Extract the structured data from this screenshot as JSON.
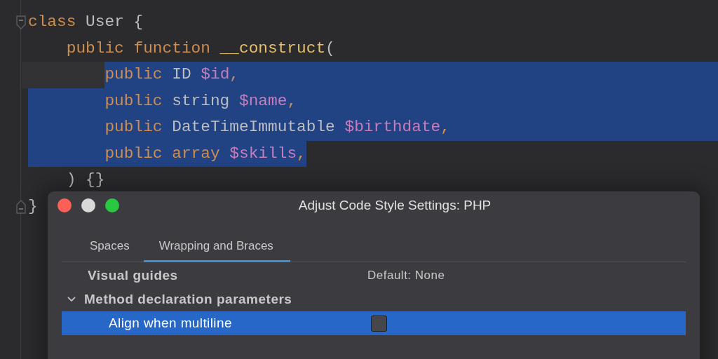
{
  "editor": {
    "lines": [
      {
        "kind": "fold_start",
        "selected": false,
        "current": false,
        "tokens": [
          {
            "kind": "keyword",
            "text": "class"
          },
          {
            "kind": "plain",
            "text": " User {"
          }
        ],
        "children": [
          {
            "selected": false,
            "current": false,
            "tokens": [
              {
                "kind": "keyword",
                "text": "public function "
              },
              {
                "kind": "func",
                "text": "__construct"
              },
              {
                "kind": "plain",
                "text": "("
              }
            ],
            "children": [
              {
                "selected": true,
                "current": true,
                "tokens": [
                  {
                    "kind": "keyword",
                    "text": "public"
                  },
                  {
                    "kind": "plain",
                    "text": " ID "
                  },
                  {
                    "kind": "var",
                    "text": "$id"
                  },
                  {
                    "kind": "keyword",
                    "text": ","
                  }
                ]
              },
              {
                "selected": true,
                "current": false,
                "tokens": [
                  {
                    "kind": "keyword",
                    "text": "public"
                  },
                  {
                    "kind": "plain",
                    "text": " string "
                  },
                  {
                    "kind": "var",
                    "text": "$name"
                  },
                  {
                    "kind": "keyword",
                    "text": ","
                  }
                ]
              },
              {
                "selected": true,
                "current": false,
                "tokens": [
                  {
                    "kind": "keyword",
                    "text": "public"
                  },
                  {
                    "kind": "plain",
                    "text": " DateTimeImmutable "
                  },
                  {
                    "kind": "var",
                    "text": "$birthdate"
                  },
                  {
                    "kind": "keyword",
                    "text": ","
                  }
                ]
              },
              {
                "selected": true,
                "current": false,
                "tokens": [
                  {
                    "kind": "keyword",
                    "text": "public array "
                  },
                  {
                    "kind": "var",
                    "text": "$skills"
                  },
                  {
                    "kind": "keyword",
                    "text": ","
                  }
                ]
              }
            ]
          },
          {
            "selected": false,
            "current": false,
            "tokens": [
              {
                "kind": "plain",
                "text": ") {}"
              }
            ]
          }
        ]
      },
      {
        "kind": "fold_end",
        "selected": false,
        "current": false,
        "tokens": [
          {
            "kind": "plain",
            "text": "}"
          }
        ]
      }
    ]
  },
  "dialog": {
    "title": "Adjust Code Style Settings: PHP",
    "tabs": [
      {
        "label": "Spaces",
        "selected": false
      },
      {
        "label": "Wrapping and Braces",
        "selected": true
      }
    ],
    "rows": [
      {
        "kind": "option",
        "label": "Visual guides",
        "value": "Default: None",
        "selected": false
      },
      {
        "kind": "group",
        "label": "Method declaration parameters",
        "expanded": true,
        "selected": false
      },
      {
        "kind": "checkbox",
        "label": "Align when multiline",
        "checked": false,
        "selected": true
      }
    ]
  }
}
